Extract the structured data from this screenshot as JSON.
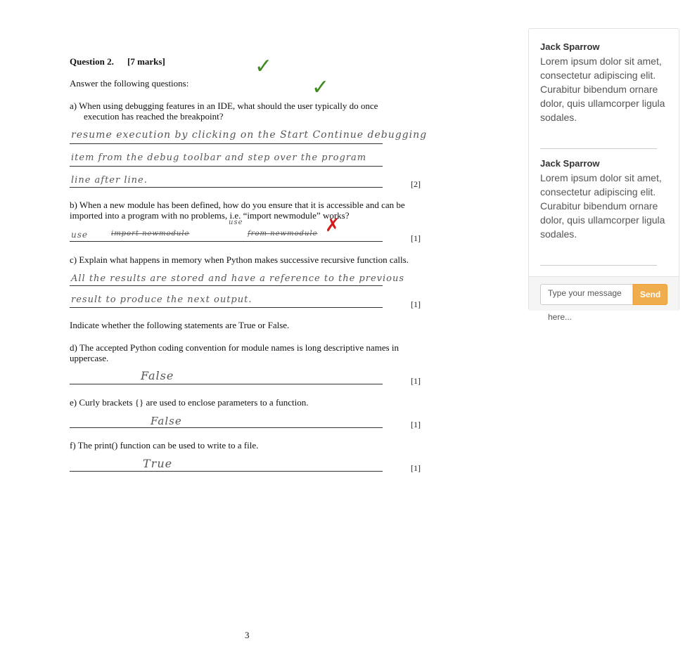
{
  "exam": {
    "heading": "Question 2.",
    "marks_total": "[7 marks]",
    "instruction": "Answer the following questions:",
    "qa": {
      "line1": "a)  When using debugging features in an IDE, what should the user typically do once",
      "line2": "execution has reached the breakpoint?",
      "hw1": "resume  execution  by  clicking  on  the  Start  Continue  debugging",
      "hw2": "item  from  the  debug  toolbar  and  step  over  the  program",
      "hw3": "line  after  line.",
      "mark": "[2]"
    },
    "qb": {
      "line1": "b) When a new module has been defined, how do you ensure that it is accessible and can be",
      "line2": "imported into a program with no problems, i.e. “import newmodule” works?",
      "hw_above": "use",
      "hw1": "use",
      "hw2": "import newmodule",
      "hw3": "from  newmodule",
      "mark": "[1]"
    },
    "qc": {
      "line1": "c) Explain what happens in memory when Python makes successive recursive function calls.",
      "hw1": "All  the  results  are  stored  and  have  a  reference  to  the  previous",
      "hw2": "result  to  produce  the  next  output.",
      "mark": "[1]"
    },
    "tf_instruction": "Indicate whether the following statements are True or False.",
    "qd": {
      "line1": "d) The accepted Python coding convention for module names is long descriptive names in",
      "line2": "uppercase.",
      "hw": "False",
      "mark": "[1]"
    },
    "qe": {
      "line1": "e) Curly brackets {} are used to enclose parameters to a function.",
      "hw": "False",
      "mark": "[1]"
    },
    "qf": {
      "line1": "f) The print() function can be used to write to a file.",
      "hw": "True",
      "mark": "[1]"
    },
    "page_number": "3",
    "tick_color": "#3f8a1f",
    "cross_color": "#d11a1a"
  },
  "chat": {
    "messages": [
      {
        "author": "Jack Sparrow",
        "body": "Lorem ipsum dolor sit amet, consectetur adipiscing elit. Curabitur bibendum ornare dolor, quis ullamcorper ligula sodales."
      },
      {
        "author": "Jack Sparrow",
        "body": "Lorem ipsum dolor sit amet, consectetur adipiscing elit. Curabitur bibendum ornare dolor, quis ullamcorper ligula sodales."
      }
    ],
    "input_placeholder": "Type your message here...",
    "send_label": "Send",
    "send_color": "#f0ad4e"
  }
}
